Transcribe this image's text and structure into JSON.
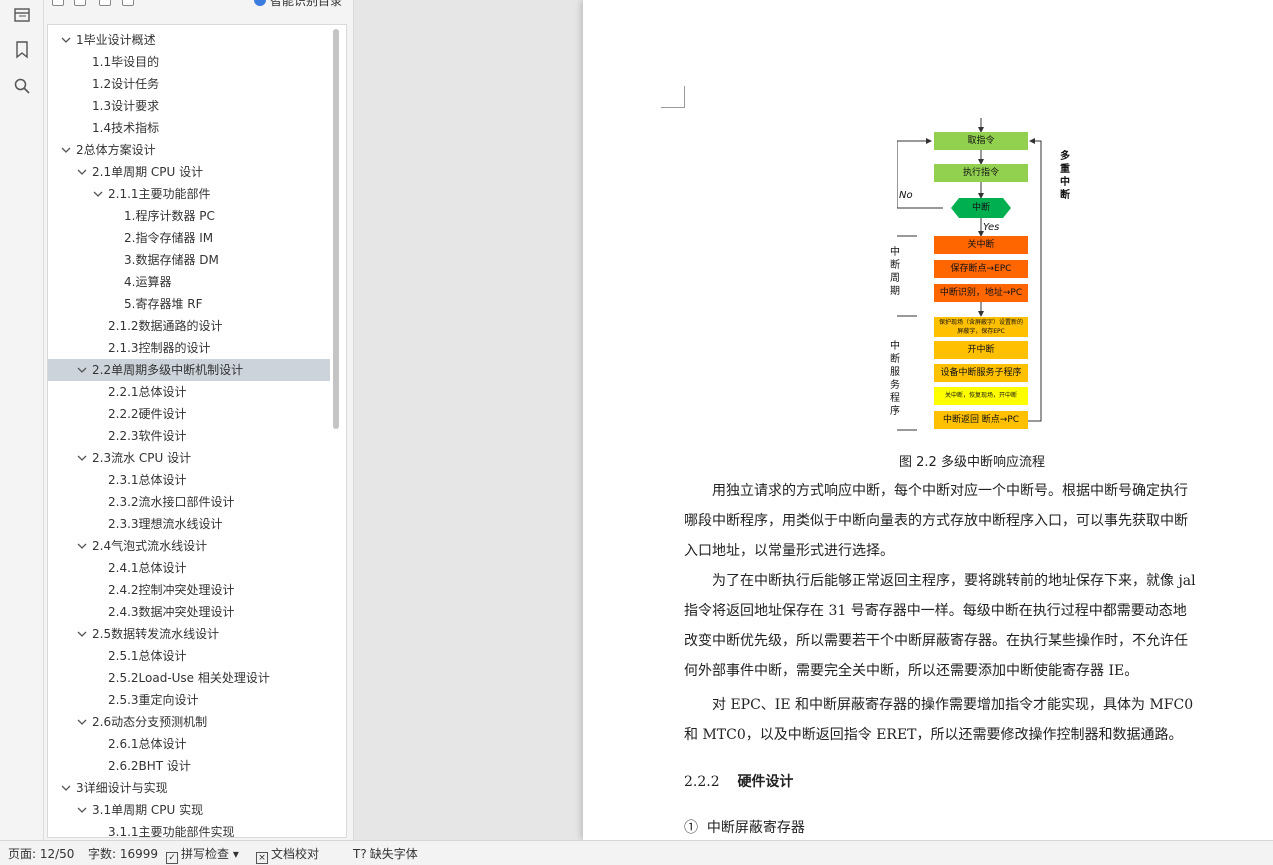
{
  "nav": {
    "smart_toc": "智能识别目录",
    "toc": [
      {
        "label": "1毕业设计概述",
        "level": 0,
        "expandable": true,
        "selected": false
      },
      {
        "label": "1.1毕设目的",
        "level": 1,
        "expandable": false,
        "selected": false
      },
      {
        "label": "1.2设计任务",
        "level": 1,
        "expandable": false,
        "selected": false
      },
      {
        "label": "1.3设计要求",
        "level": 1,
        "expandable": false,
        "selected": false
      },
      {
        "label": "1.4技术指标",
        "level": 1,
        "expandable": false,
        "selected": false
      },
      {
        "label": "2总体方案设计",
        "level": 0,
        "expandable": true,
        "selected": false
      },
      {
        "label": "2.1单周期 CPU 设计",
        "level": 1,
        "expandable": true,
        "selected": false
      },
      {
        "label": "2.1.1主要功能部件",
        "level": 2,
        "expandable": true,
        "selected": false
      },
      {
        "label": "1.程序计数器 PC",
        "level": 3,
        "expandable": false,
        "selected": false
      },
      {
        "label": "2.指令存储器 IM",
        "level": 3,
        "expandable": false,
        "selected": false
      },
      {
        "label": "3.数据存储器 DM",
        "level": 3,
        "expandable": false,
        "selected": false
      },
      {
        "label": "4.运算器",
        "level": 3,
        "expandable": false,
        "selected": false
      },
      {
        "label": "5.寄存器堆 RF",
        "level": 3,
        "expandable": false,
        "selected": false
      },
      {
        "label": "2.1.2数据通路的设计",
        "level": 2,
        "expandable": false,
        "selected": false
      },
      {
        "label": "2.1.3控制器的设计",
        "level": 2,
        "expandable": false,
        "selected": false
      },
      {
        "label": "2.2单周期多级中断机制设计",
        "level": 1,
        "expandable": true,
        "selected": true
      },
      {
        "label": "2.2.1总体设计",
        "level": 2,
        "expandable": false,
        "selected": false
      },
      {
        "label": "2.2.2硬件设计",
        "level": 2,
        "expandable": false,
        "selected": false
      },
      {
        "label": "2.2.3软件设计",
        "level": 2,
        "expandable": false,
        "selected": false
      },
      {
        "label": "2.3流水 CPU 设计",
        "level": 1,
        "expandable": true,
        "selected": false
      },
      {
        "label": "2.3.1总体设计",
        "level": 2,
        "expandable": false,
        "selected": false
      },
      {
        "label": "2.3.2流水接口部件设计",
        "level": 2,
        "expandable": false,
        "selected": false
      },
      {
        "label": "2.3.3理想流水线设计",
        "level": 2,
        "expandable": false,
        "selected": false
      },
      {
        "label": "2.4气泡式流水线设计",
        "level": 1,
        "expandable": true,
        "selected": false
      },
      {
        "label": "2.4.1总体设计",
        "level": 2,
        "expandable": false,
        "selected": false
      },
      {
        "label": "2.4.2控制冲突处理设计",
        "level": 2,
        "expandable": false,
        "selected": false
      },
      {
        "label": "2.4.3数据冲突处理设计",
        "level": 2,
        "expandable": false,
        "selected": false
      },
      {
        "label": "2.5数据转发流水线设计",
        "level": 1,
        "expandable": true,
        "selected": false
      },
      {
        "label": "2.5.1总体设计",
        "level": 2,
        "expandable": false,
        "selected": false
      },
      {
        "label": "2.5.2Load-Use 相关处理设计",
        "level": 2,
        "expandable": false,
        "selected": false
      },
      {
        "label": "2.5.3重定向设计",
        "level": 2,
        "expandable": false,
        "selected": false
      },
      {
        "label": "2.6动态分支预测机制",
        "level": 1,
        "expandable": true,
        "selected": false
      },
      {
        "label": "2.6.1总体设计",
        "level": 2,
        "expandable": false,
        "selected": false
      },
      {
        "label": "2.6.2BHT 设计",
        "level": 2,
        "expandable": false,
        "selected": false
      },
      {
        "label": "3详细设计与实现",
        "level": 0,
        "expandable": true,
        "selected": false
      },
      {
        "label": "3.1单周期 CPU 实现",
        "level": 1,
        "expandable": true,
        "selected": false
      },
      {
        "label": "3.1.1主要功能部件实现",
        "level": 2,
        "expandable": false,
        "selected": false
      }
    ]
  },
  "flowchart": {
    "boxes": [
      {
        "label": "取指令",
        "style": "green"
      },
      {
        "label": "执行指令",
        "style": "green"
      },
      {
        "label": "中断",
        "style": "hex"
      },
      {
        "label": "关中断",
        "style": "orange"
      },
      {
        "label": "保存断点→EPC",
        "style": "orange"
      },
      {
        "label": "中断识别，地址→PC",
        "style": "orange"
      },
      {
        "label": "保护现场（含屏蔽字）设置新的屏蔽字，保存EPC",
        "style": "gold"
      },
      {
        "label": "开中断",
        "style": "gold"
      },
      {
        "label": "设备中断服务子程序",
        "style": "gold"
      },
      {
        "label": "关中断，恢复现场，开中断",
        "style": "yellow"
      },
      {
        "label": "中断返回 断点→PC",
        "style": "gold"
      }
    ],
    "no_label": "No",
    "yes_label": "Yes",
    "side_multi": "多重中断",
    "side_cycle": "中断周期",
    "side_service": "中断服务程序",
    "colors": {
      "green": "#92d050",
      "hex": "#00b050",
      "orange": "#ff6600",
      "gold": "#ffc000",
      "yellow": "#ffff00"
    }
  },
  "document": {
    "caption": "图 2.2 多级中断响应流程",
    "para1": [
      "　　用独立请求的方式响应中断，每个中断对应一个中断号。根据中断号确定执行",
      "哪段中断程序，用类似于中断向量表的方式存放中断程序入口，可以事先获取中断",
      "入口地址，以常量形式进行选择。"
    ],
    "para2": [
      "　　为了在中断执行后能够正常返回主程序，要将跳转前的地址保存下来，就像 jal",
      "指令将返回地址保存在 31 号寄存器中一样。每级中断在执行过程中都需要动态地",
      "改变中断优先级，所以需要若干个中断屏蔽寄存器。在执行某些操作时，不允许任",
      "何外部事件中断，需要完全关中断，所以还需要添加中断使能寄存器 IE。"
    ],
    "para3": [
      "　　对 EPC、IE 和中断屏蔽寄存器的操作需要增加指令才能实现，具体为 MFC0",
      "和 MTC0，以及中断返回指令 ERET，所以还需要修改操作控制器和数据通路。"
    ],
    "section_num": "2.2.2",
    "section_title": "硬件设计",
    "item_num": "①",
    "item_title": "中断屏蔽寄存器"
  },
  "status": {
    "page": "页面: 12/50",
    "words": "字数: 16999",
    "spell": "拼写检查",
    "proof": "文档校对",
    "missing_font": "缺失字体"
  }
}
